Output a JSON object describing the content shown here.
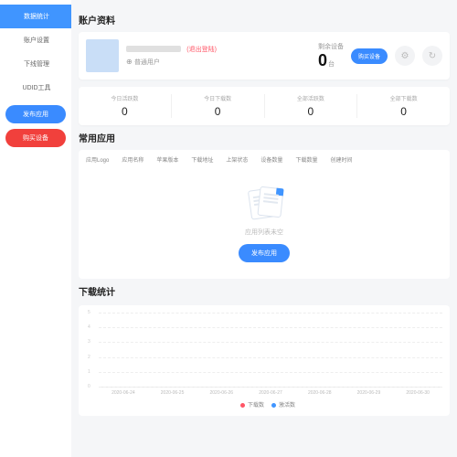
{
  "sidebar": {
    "items": [
      "数据统计",
      "账户设置",
      "下线管理",
      "UDID工具"
    ],
    "activeIndex": 0,
    "publish_btn": "发布应用",
    "buy_btn": "购买设备"
  },
  "profile": {
    "title": "账户资料",
    "logout": "(退出登陆)",
    "role": "普通用户",
    "remain_label": "剩余设备",
    "remain_value": "0",
    "remain_unit": "台",
    "buy_btn": "购买设备"
  },
  "stats": [
    {
      "lbl": "今日活跃数",
      "val": "0"
    },
    {
      "lbl": "今日下载数",
      "val": "0"
    },
    {
      "lbl": "全部活跃数",
      "val": "0"
    },
    {
      "lbl": "全部下载数",
      "val": "0"
    }
  ],
  "apps": {
    "title": "常用应用",
    "tabs": [
      "应用Logo",
      "应用名称",
      "苹果版本",
      "下载地址",
      "上架状态",
      "设备数量",
      "下载数量",
      "创建时间"
    ],
    "empty_text": "应用列表未空",
    "publish_btn": "发布应用"
  },
  "chart_data": {
    "title": "下载统计",
    "type": "line",
    "categories": [
      "2020-06-24",
      "2020-06-25",
      "2020-06-26",
      "2020-06-27",
      "2020-06-28",
      "2020-06-29",
      "2020-06-30"
    ],
    "series": [
      {
        "name": "下载数",
        "color": "#f56",
        "values": [
          0,
          0,
          0,
          0,
          0,
          0,
          0
        ]
      },
      {
        "name": "激活数",
        "color": "#4095ff",
        "values": [
          0,
          0,
          0,
          0,
          0,
          0,
          0
        ]
      }
    ],
    "yticks": [
      0,
      1,
      2,
      3,
      4,
      5
    ],
    "ylim": [
      0,
      5
    ]
  }
}
